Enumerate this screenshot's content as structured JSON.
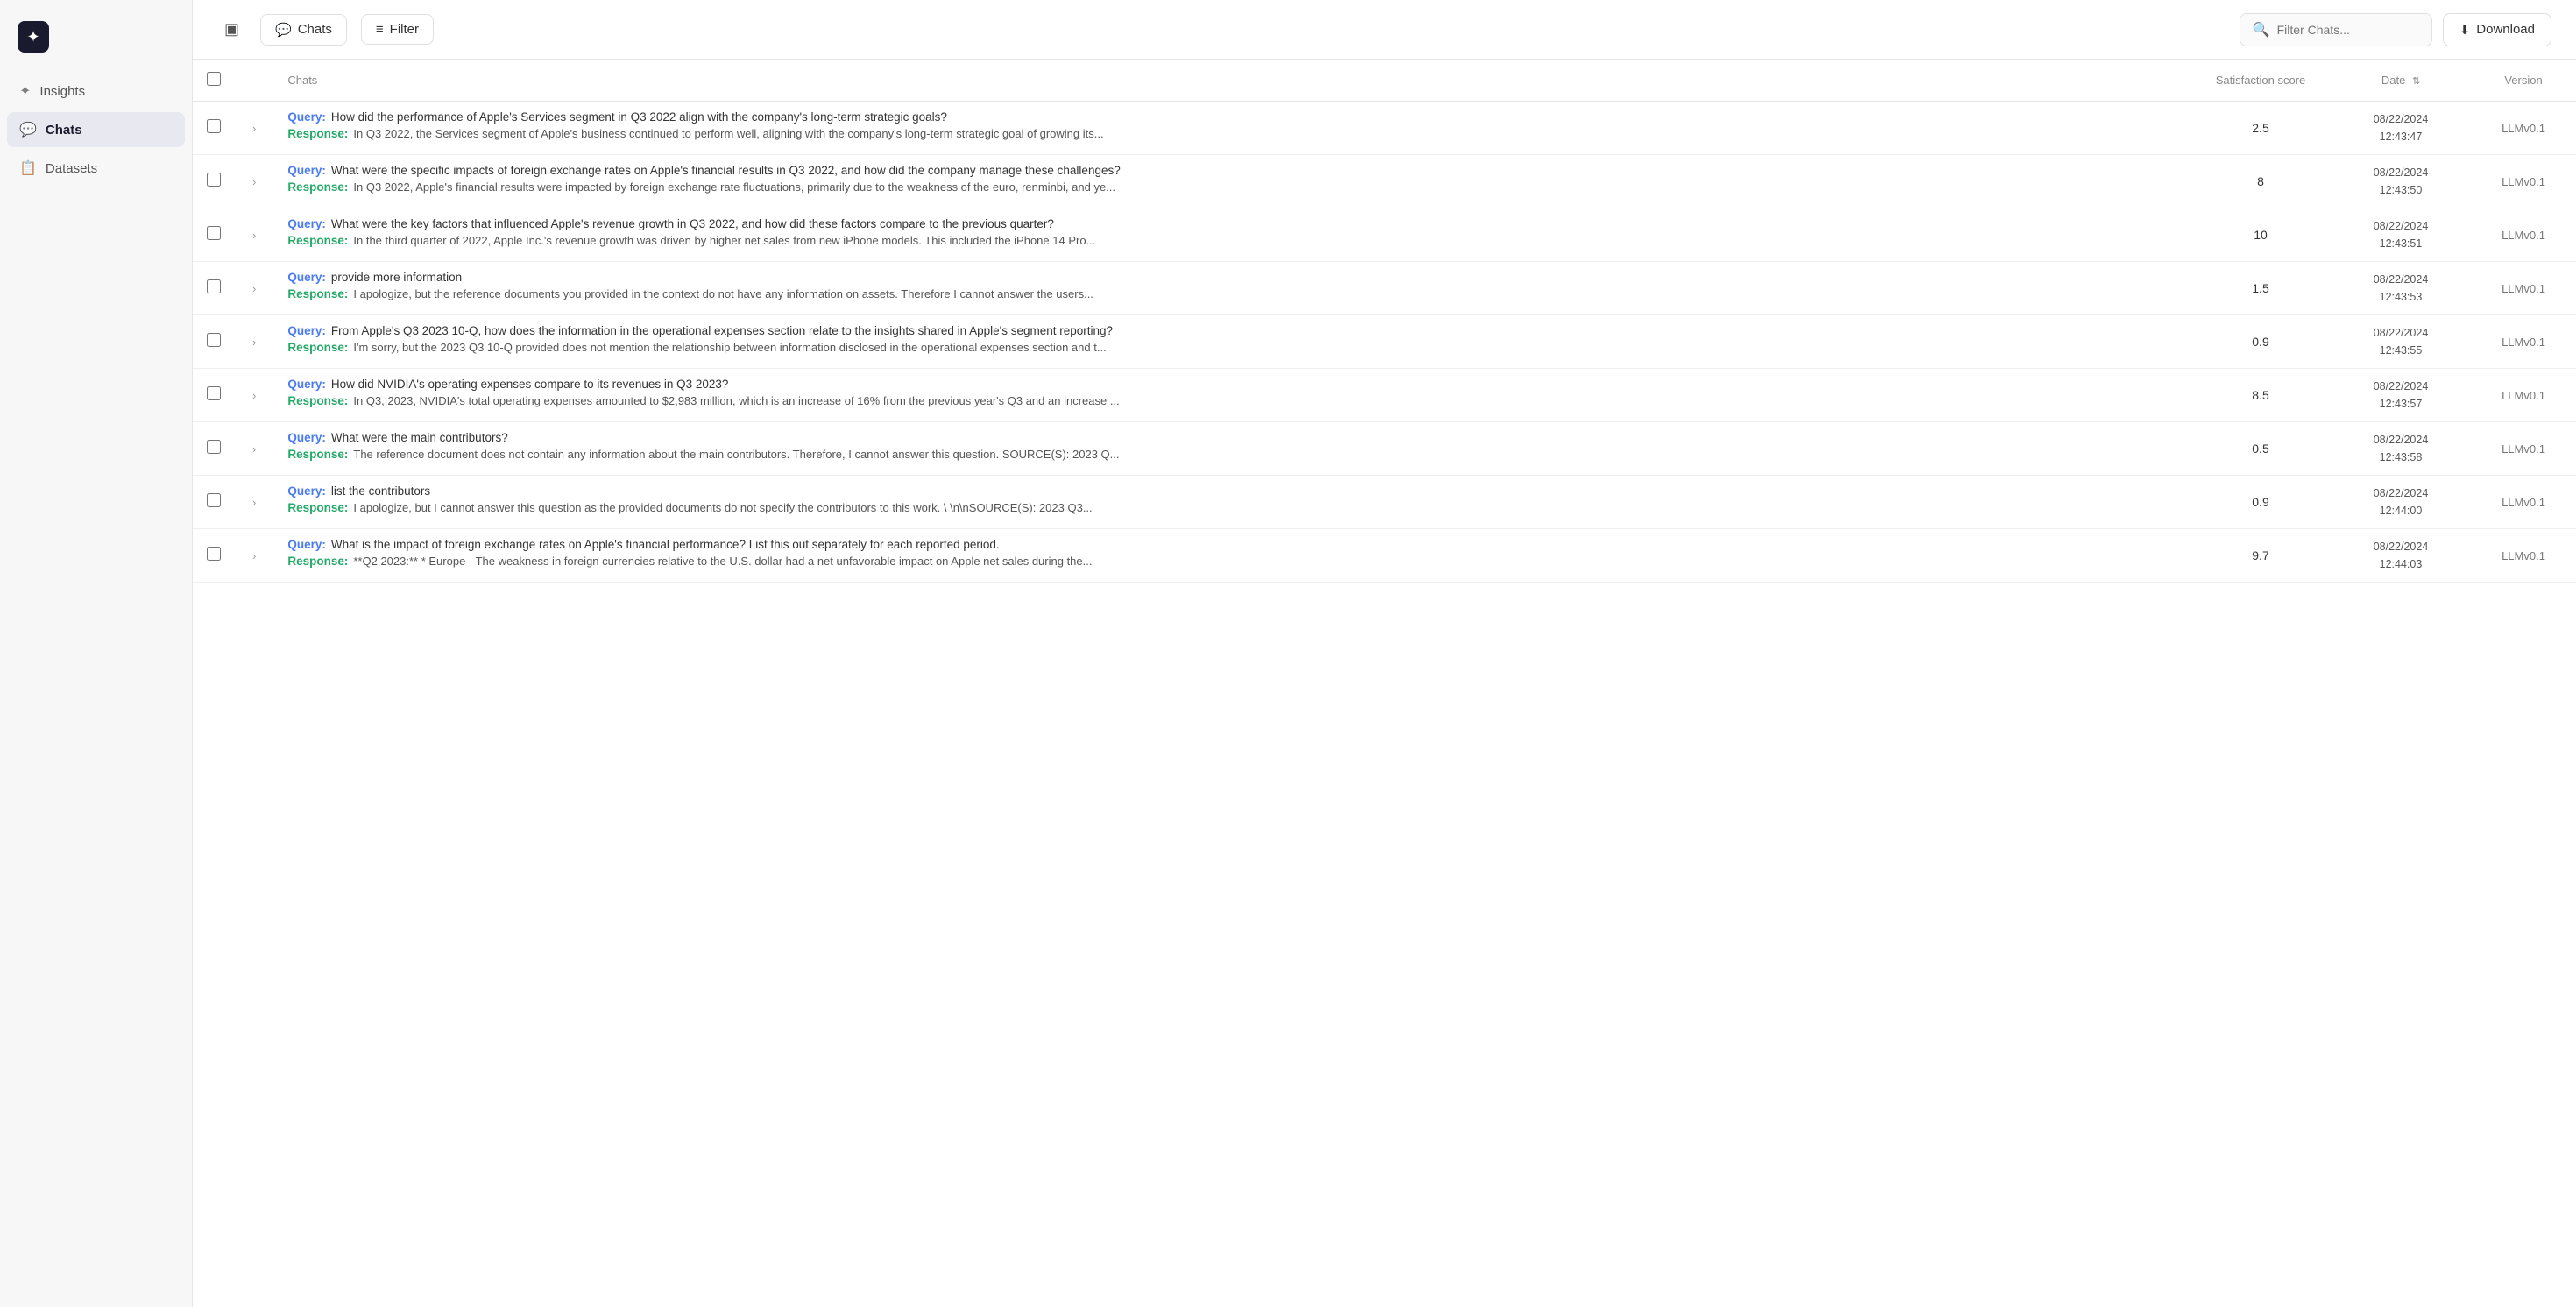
{
  "sidebar": {
    "logo_symbol": "✦",
    "items": [
      {
        "id": "insights",
        "label": "Insights",
        "icon": "✦",
        "active": false
      },
      {
        "id": "chats",
        "label": "Chats",
        "icon": "💬",
        "active": true
      },
      {
        "id": "datasets",
        "label": "Datasets",
        "icon": "📋",
        "active": false
      }
    ]
  },
  "topbar": {
    "toggle_label": "▣",
    "chats_tab_label": "Chats",
    "chats_tab_icon": "💬",
    "filter_label": "Filter",
    "filter_icon": "≡",
    "search_placeholder": "Filter Chats...",
    "download_label": "Download",
    "download_icon": "⬇"
  },
  "table": {
    "columns": {
      "checkbox": "",
      "expand": "",
      "chats": "Chats",
      "score": "Satisfaction score",
      "date": "Date",
      "version": "Version"
    },
    "rows": [
      {
        "id": 1,
        "query": "How did the performance of Apple's Services segment in Q3 2022 align with the company's long-term strategic goals?",
        "response": "In Q3 2022, the Services segment of Apple's business continued to perform well, aligning with the company's long-term strategic goal of growing its...",
        "score": "2.5",
        "date": "08/22/2024\n12:43:47",
        "version": "LLMv0.1"
      },
      {
        "id": 2,
        "query": "What were the specific impacts of foreign exchange rates on Apple's financial results in Q3 2022, and how did the company manage these challenges?",
        "response": "In Q3 2022, Apple's financial results were impacted by foreign exchange rate fluctuations, primarily due to the weakness of the euro, renminbi, and ye...",
        "score": "8",
        "date": "08/22/2024\n12:43:50",
        "version": "LLMv0.1"
      },
      {
        "id": 3,
        "query": "What were the key factors that influenced Apple's revenue growth in Q3 2022, and how did these factors compare to the previous quarter?",
        "response": "In the third quarter of 2022, Apple Inc.'s revenue growth was driven by higher net sales from new iPhone models. This included the iPhone 14 Pro...",
        "score": "10",
        "date": "08/22/2024\n12:43:51",
        "version": "LLMv0.1"
      },
      {
        "id": 4,
        "query": "provide more information",
        "response": "I apologize, but the reference documents you provided in the context do not have any information on assets. Therefore I cannot answer the users...",
        "score": "1.5",
        "date": "08/22/2024\n12:43:53",
        "version": "LLMv0.1"
      },
      {
        "id": 5,
        "query": "From Apple's Q3 2023 10-Q, how does the information in the operational expenses section relate to the insights shared in Apple's segment reporting?",
        "response": "I'm sorry, but the 2023 Q3 10-Q provided does not mention the relationship between information disclosed in the operational expenses section and t...",
        "score": "0.9",
        "date": "08/22/2024\n12:43:55",
        "version": "LLMv0.1"
      },
      {
        "id": 6,
        "query": "How did NVIDIA's operating expenses compare to its revenues in Q3 2023?",
        "response": "In Q3, 2023, NVIDIA's total operating expenses amounted to $2,983 million, which is an increase of 16% from the previous year's Q3 and an increase ...",
        "score": "8.5",
        "date": "08/22/2024\n12:43:57",
        "version": "LLMv0.1"
      },
      {
        "id": 7,
        "query": "What were the main contributors?",
        "response": "The reference document does not contain any information about the main contributors. Therefore, I cannot answer this question. SOURCE(S): 2023 Q...",
        "score": "0.5",
        "date": "08/22/2024\n12:43:58",
        "version": "LLMv0.1"
      },
      {
        "id": 8,
        "query": "list the contributors",
        "response": "I apologize, but I cannot answer this question as the provided documents do not specify the contributors to this work. \\ \\n\\nSOURCE(S): 2023 Q3...",
        "score": "0.9",
        "date": "08/22/2024\n12:44:00",
        "version": "LLMv0.1"
      },
      {
        "id": 9,
        "query": "What is the impact of foreign exchange rates on Apple's financial performance? List this out separately for each reported period.",
        "response": "**Q2 2023:** * Europe - The weakness in foreign currencies relative to the U.S. dollar had a net unfavorable impact on Apple net sales during the...",
        "score": "9.7",
        "date": "08/22/2024\n12:44:03",
        "version": "LLMv0.1"
      }
    ],
    "query_label": "Query:",
    "response_label": "Response:"
  }
}
